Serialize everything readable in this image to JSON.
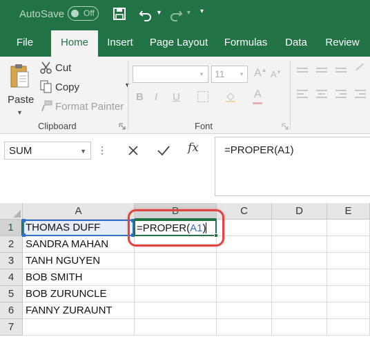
{
  "title_bar": {
    "autosave_label": "AutoSave",
    "autosave_state": "Off",
    "accent_color": "#217346"
  },
  "tabs": [
    "File",
    "Home",
    "Insert",
    "Page Layout",
    "Formulas",
    "Data",
    "Review"
  ],
  "active_tab": "Home",
  "ribbon": {
    "clipboard": {
      "paste_label": "Paste",
      "cut_label": "Cut",
      "copy_label": "Copy",
      "format_painter_label": "Format Painter",
      "group_label": "Clipboard"
    },
    "font": {
      "font_name": "",
      "font_size": "11",
      "group_label": "Font"
    }
  },
  "formula_bar": {
    "name_box": "SUM",
    "fx_label": "fx",
    "formula": "=PROPER(A1)"
  },
  "grid": {
    "columns": [
      "A",
      "B",
      "C",
      "D",
      "E"
    ],
    "rows": [
      "1",
      "2",
      "3",
      "4",
      "5",
      "6",
      "7"
    ],
    "column_a": [
      "THOMAS DUFF",
      "SANDRA MAHAN",
      "TANH NGUYEN",
      "BOB SMITH",
      "BOB ZURUNCLE",
      "FANNY ZURAUNT",
      ""
    ],
    "active_cell": {
      "ref": "B1",
      "prefix": "=PROPER(",
      "ref_arg": "A1",
      "suffix": ")"
    },
    "reference_color": "#2e6fc8",
    "highlight_color": "#e0443e"
  }
}
